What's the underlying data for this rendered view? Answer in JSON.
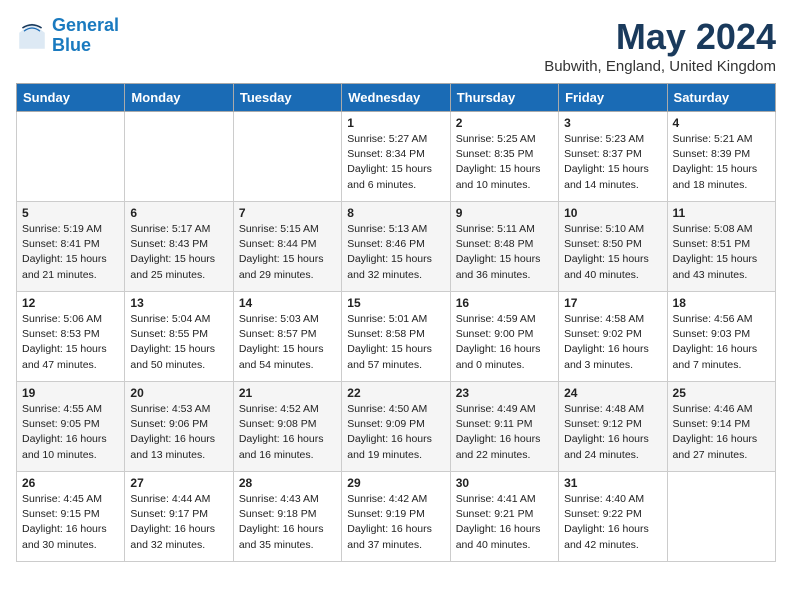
{
  "logo": {
    "line1": "General",
    "line2": "Blue"
  },
  "title": "May 2024",
  "location": "Bubwith, England, United Kingdom",
  "days_header": [
    "Sunday",
    "Monday",
    "Tuesday",
    "Wednesday",
    "Thursday",
    "Friday",
    "Saturday"
  ],
  "weeks": [
    [
      {
        "day": "",
        "text": ""
      },
      {
        "day": "",
        "text": ""
      },
      {
        "day": "",
        "text": ""
      },
      {
        "day": "1",
        "text": "Sunrise: 5:27 AM\nSunset: 8:34 PM\nDaylight: 15 hours\nand 6 minutes."
      },
      {
        "day": "2",
        "text": "Sunrise: 5:25 AM\nSunset: 8:35 PM\nDaylight: 15 hours\nand 10 minutes."
      },
      {
        "day": "3",
        "text": "Sunrise: 5:23 AM\nSunset: 8:37 PM\nDaylight: 15 hours\nand 14 minutes."
      },
      {
        "day": "4",
        "text": "Sunrise: 5:21 AM\nSunset: 8:39 PM\nDaylight: 15 hours\nand 18 minutes."
      }
    ],
    [
      {
        "day": "5",
        "text": "Sunrise: 5:19 AM\nSunset: 8:41 PM\nDaylight: 15 hours\nand 21 minutes."
      },
      {
        "day": "6",
        "text": "Sunrise: 5:17 AM\nSunset: 8:43 PM\nDaylight: 15 hours\nand 25 minutes."
      },
      {
        "day": "7",
        "text": "Sunrise: 5:15 AM\nSunset: 8:44 PM\nDaylight: 15 hours\nand 29 minutes."
      },
      {
        "day": "8",
        "text": "Sunrise: 5:13 AM\nSunset: 8:46 PM\nDaylight: 15 hours\nand 32 minutes."
      },
      {
        "day": "9",
        "text": "Sunrise: 5:11 AM\nSunset: 8:48 PM\nDaylight: 15 hours\nand 36 minutes."
      },
      {
        "day": "10",
        "text": "Sunrise: 5:10 AM\nSunset: 8:50 PM\nDaylight: 15 hours\nand 40 minutes."
      },
      {
        "day": "11",
        "text": "Sunrise: 5:08 AM\nSunset: 8:51 PM\nDaylight: 15 hours\nand 43 minutes."
      }
    ],
    [
      {
        "day": "12",
        "text": "Sunrise: 5:06 AM\nSunset: 8:53 PM\nDaylight: 15 hours\nand 47 minutes."
      },
      {
        "day": "13",
        "text": "Sunrise: 5:04 AM\nSunset: 8:55 PM\nDaylight: 15 hours\nand 50 minutes."
      },
      {
        "day": "14",
        "text": "Sunrise: 5:03 AM\nSunset: 8:57 PM\nDaylight: 15 hours\nand 54 minutes."
      },
      {
        "day": "15",
        "text": "Sunrise: 5:01 AM\nSunset: 8:58 PM\nDaylight: 15 hours\nand 57 minutes."
      },
      {
        "day": "16",
        "text": "Sunrise: 4:59 AM\nSunset: 9:00 PM\nDaylight: 16 hours\nand 0 minutes."
      },
      {
        "day": "17",
        "text": "Sunrise: 4:58 AM\nSunset: 9:02 PM\nDaylight: 16 hours\nand 3 minutes."
      },
      {
        "day": "18",
        "text": "Sunrise: 4:56 AM\nSunset: 9:03 PM\nDaylight: 16 hours\nand 7 minutes."
      }
    ],
    [
      {
        "day": "19",
        "text": "Sunrise: 4:55 AM\nSunset: 9:05 PM\nDaylight: 16 hours\nand 10 minutes."
      },
      {
        "day": "20",
        "text": "Sunrise: 4:53 AM\nSunset: 9:06 PM\nDaylight: 16 hours\nand 13 minutes."
      },
      {
        "day": "21",
        "text": "Sunrise: 4:52 AM\nSunset: 9:08 PM\nDaylight: 16 hours\nand 16 minutes."
      },
      {
        "day": "22",
        "text": "Sunrise: 4:50 AM\nSunset: 9:09 PM\nDaylight: 16 hours\nand 19 minutes."
      },
      {
        "day": "23",
        "text": "Sunrise: 4:49 AM\nSunset: 9:11 PM\nDaylight: 16 hours\nand 22 minutes."
      },
      {
        "day": "24",
        "text": "Sunrise: 4:48 AM\nSunset: 9:12 PM\nDaylight: 16 hours\nand 24 minutes."
      },
      {
        "day": "25",
        "text": "Sunrise: 4:46 AM\nSunset: 9:14 PM\nDaylight: 16 hours\nand 27 minutes."
      }
    ],
    [
      {
        "day": "26",
        "text": "Sunrise: 4:45 AM\nSunset: 9:15 PM\nDaylight: 16 hours\nand 30 minutes."
      },
      {
        "day": "27",
        "text": "Sunrise: 4:44 AM\nSunset: 9:17 PM\nDaylight: 16 hours\nand 32 minutes."
      },
      {
        "day": "28",
        "text": "Sunrise: 4:43 AM\nSunset: 9:18 PM\nDaylight: 16 hours\nand 35 minutes."
      },
      {
        "day": "29",
        "text": "Sunrise: 4:42 AM\nSunset: 9:19 PM\nDaylight: 16 hours\nand 37 minutes."
      },
      {
        "day": "30",
        "text": "Sunrise: 4:41 AM\nSunset: 9:21 PM\nDaylight: 16 hours\nand 40 minutes."
      },
      {
        "day": "31",
        "text": "Sunrise: 4:40 AM\nSunset: 9:22 PM\nDaylight: 16 hours\nand 42 minutes."
      },
      {
        "day": "",
        "text": ""
      }
    ]
  ]
}
